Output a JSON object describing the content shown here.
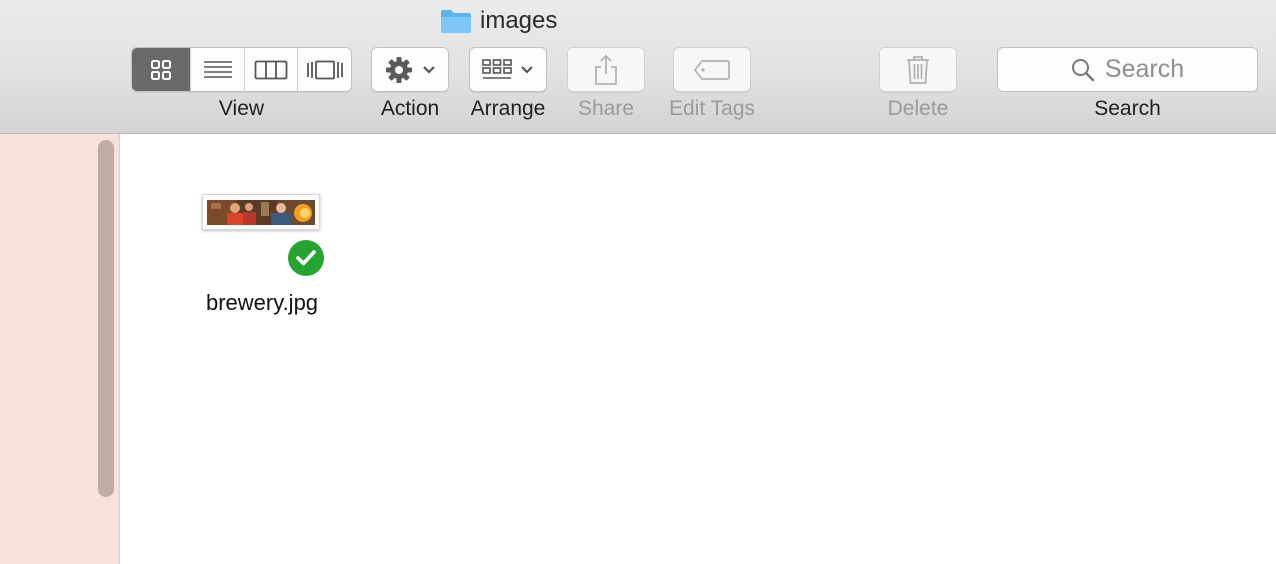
{
  "window": {
    "title": "images",
    "title_icon": "folder-icon"
  },
  "toolbar": {
    "view": {
      "label": "View",
      "modes": [
        {
          "name": "icon-view",
          "icon": "grid-icon",
          "active": true
        },
        {
          "name": "list-view",
          "icon": "list-icon",
          "active": false
        },
        {
          "name": "column-view",
          "icon": "columns-icon",
          "active": false
        },
        {
          "name": "gallery-view",
          "icon": "cover-flow-icon",
          "active": false
        }
      ]
    },
    "action": {
      "label": "Action",
      "icon": "gear-icon"
    },
    "arrange": {
      "label": "Arrange",
      "icon": "arrange-grid-icon"
    },
    "share": {
      "label": "Share",
      "icon": "share-icon",
      "enabled": false
    },
    "edit_tags": {
      "label": "Edit Tags",
      "icon": "tag-icon",
      "enabled": false
    },
    "delete": {
      "label": "Delete",
      "icon": "trash-icon",
      "enabled": false
    },
    "search": {
      "label": "Search",
      "placeholder": "Search",
      "icon": "magnifier-icon"
    }
  },
  "files": [
    {
      "name": "brewery.jpg",
      "status": "synced",
      "status_icon": "checkmark-icon",
      "status_color": "#26a432"
    }
  ],
  "colors": {
    "sidebar_bg": "#f6e2da",
    "active_segment": "#6a6a6a",
    "folder_blue": "#5ab3ee",
    "sync_green": "#26a432"
  }
}
